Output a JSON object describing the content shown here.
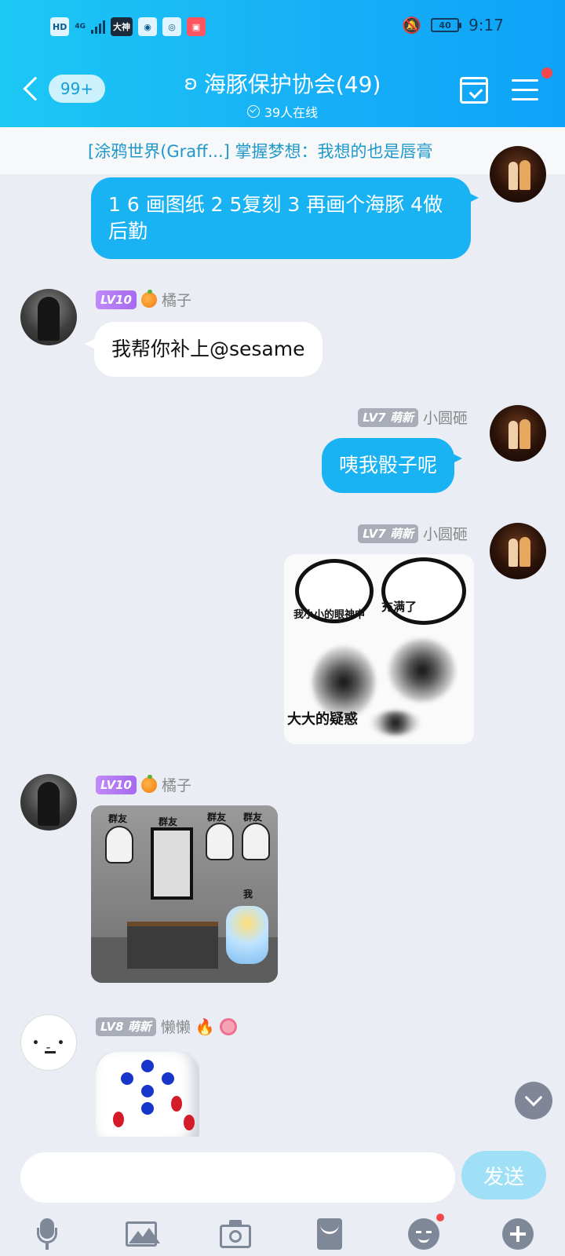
{
  "status_bar": {
    "left_chips": [
      "HD",
      "4G",
      "大神"
    ],
    "time": "9:17",
    "battery": "40"
  },
  "header": {
    "back_badge": "99+",
    "title": "海豚保护协会(49)",
    "online": "39人在线"
  },
  "notice": {
    "text": "[涂鸦世界(Graff...] 掌握梦想：我想的也是唇膏"
  },
  "messages": [
    {
      "side": "right",
      "text": "1 6 画图纸 2 5复刻 3 再画个海豚 4做后勤"
    },
    {
      "side": "left",
      "level": "LV10",
      "sender": "橘子",
      "text": "我帮你补上@sesame"
    },
    {
      "side": "right",
      "level": "LV7",
      "title": "萌新",
      "sender": "小圆砸",
      "text": "咦我骰子呢"
    },
    {
      "side": "right",
      "level": "LV7",
      "title": "萌新",
      "sender": "小圆砸",
      "image_captions": [
        "我小小的眼神中",
        "充满了",
        "大大的疑惑"
      ]
    },
    {
      "side": "left",
      "level": "LV10",
      "sender": "橘子",
      "image_captions": [
        "群友",
        "群友",
        "群友",
        "群友",
        "我"
      ]
    },
    {
      "side": "left",
      "level": "LV8",
      "title": "萌新",
      "sender": "懒懒",
      "type": "dice",
      "dice_value": 5
    }
  ],
  "input": {
    "placeholder": "",
    "send_label": "发送"
  },
  "toolbar": {
    "icons": [
      "microphone-icon",
      "image-icon",
      "camera-icon",
      "red-packet-icon",
      "emoji-icon",
      "plus-icon"
    ]
  },
  "colors": {
    "header": "#17b0f7",
    "bubble_blue": "#19b3f3",
    "level_purple": "#a56af0",
    "level_gray": "#a9adb8"
  }
}
